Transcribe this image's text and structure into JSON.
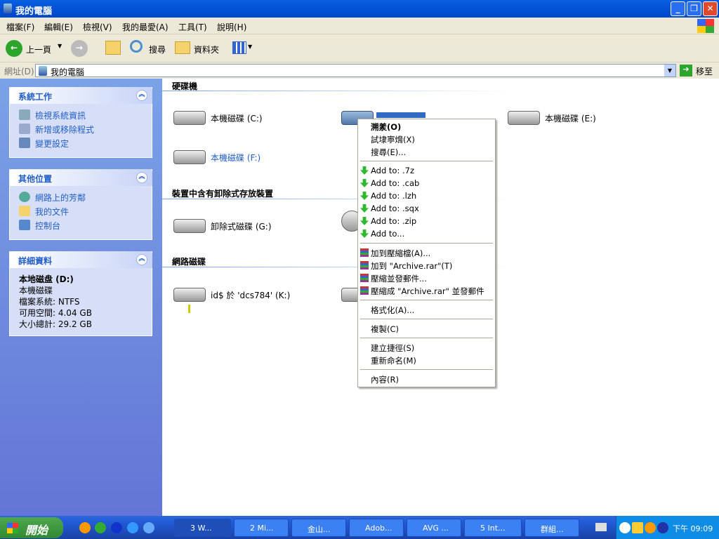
{
  "window": {
    "title": "我的電腦"
  },
  "menu": [
    "檔案(F)",
    "編輯(E)",
    "檢視(V)",
    "我的最愛(A)",
    "工具(T)",
    "說明(H)"
  ],
  "toolbar": {
    "back": "上一頁",
    "search": "搜尋",
    "folders": "資料夾"
  },
  "address": {
    "label": "網址(D)",
    "value": "我的電腦",
    "go": "移至"
  },
  "sidebar": {
    "system_tasks": {
      "title": "系統工作",
      "items": [
        "檢視系統資訊",
        "新增或移除程式",
        "變更設定"
      ]
    },
    "other_places": {
      "title": "其他位置",
      "items": [
        "網路上的芳鄰",
        "我的文件",
        "控制台"
      ]
    },
    "details": {
      "title": "詳細資料",
      "name": "本地磁盘 (D:)",
      "type": "本機磁碟",
      "fs": "檔案系統: NTFS",
      "free": "可用空間: 4.04 GB",
      "total": "大小總計: 29.2 GB"
    }
  },
  "content": {
    "sections": {
      "hdd": "硬碟機",
      "removable": "裝置中含有卸除式存放裝置",
      "network": "網路磁碟"
    },
    "drives": {
      "c": "本機磁碟 (C:)",
      "e": "本機磁碟 (E:)",
      "f": "本機磁碟 (F:)",
      "g": "卸除式磁碟 (G:)",
      "k": "id$ 於 'dcs784' (K:)"
    }
  },
  "context_menu": {
    "open": "溯羕(O)",
    "explore": "試埭寕熁(X)",
    "search": "搜尋(E)...",
    "add7z": "Add to: .7z",
    "addcab": "Add to: .cab",
    "addlzh": "Add to: .lzh",
    "addsqx": "Add to: .sqx",
    "addzip": "Add to: .zip",
    "addto": "Add to...",
    "rar_add": "加到壓縮檔(A)...",
    "rar_add_archive": "加到 \"Archive.rar\"(T)",
    "rar_email": "壓縮並發郵件...",
    "rar_email_archive": "壓縮成 \"Archive.rar\" 並發郵件",
    "format": "格式化(A)...",
    "copy": "複製(C)",
    "shortcut": "建立捷徑(S)",
    "rename": "重新命名(M)",
    "properties": "內容(R)"
  },
  "taskbar": {
    "start": "開始",
    "buttons": [
      "3 W...",
      "2 Mi...",
      "金山...",
      "Adob...",
      "AVG ...",
      "5 Int...",
      "群組..."
    ],
    "clock": "下午 09:09"
  }
}
